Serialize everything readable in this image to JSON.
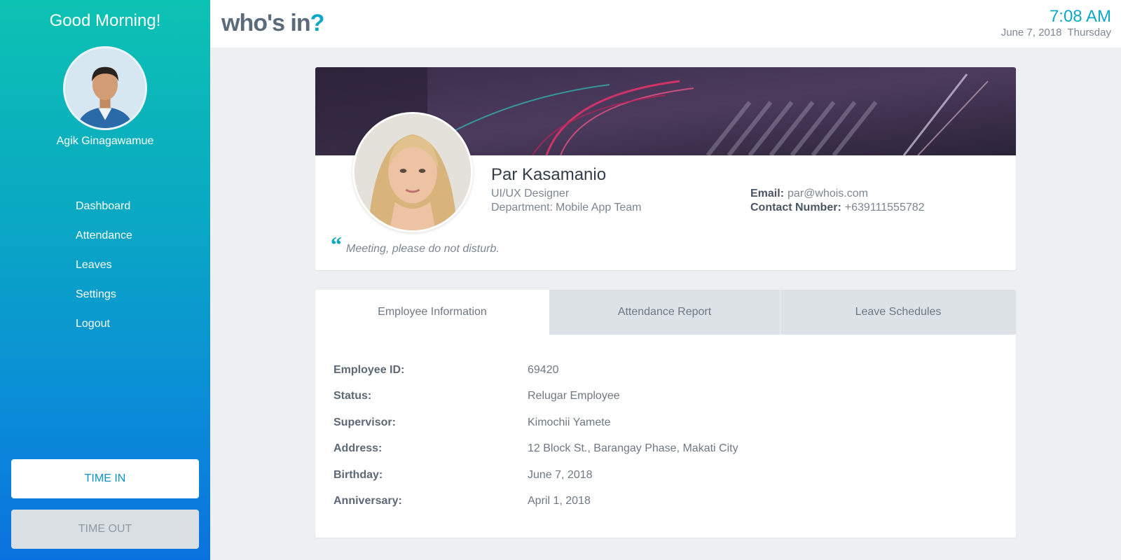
{
  "sidebar": {
    "greeting": "Good Morning!",
    "user_name": "Agik Ginagawamue",
    "nav": [
      "Dashboard",
      "Attendance",
      "Leaves",
      "Settings",
      "Logout"
    ],
    "time_in_label": "TIME IN",
    "time_out_label": "TIME OUT"
  },
  "header": {
    "logo_text": "who's in",
    "logo_mark": "?",
    "time": "7:08 AM",
    "date": "June 7, 2018",
    "day": "Thursday"
  },
  "profile": {
    "name": "Par Kasamanio",
    "title": "UI/UX Designer",
    "department_label": "Department:",
    "department": "Mobile App Team",
    "email_label": "Email:",
    "email": "par@whois.com",
    "contact_label": "Contact Number:",
    "contact": "+639111555782",
    "status_quote": "Meeting, please do not disturb."
  },
  "tabs": [
    "Employee Information",
    "Attendance Report",
    "Leave Schedules"
  ],
  "employee_info": [
    {
      "label": "Employee ID:",
      "value": "69420"
    },
    {
      "label": "Status:",
      "value": "Relugar Employee"
    },
    {
      "label": "Supervisor:",
      "value": "Kimochii Yamete"
    },
    {
      "label": "Address:",
      "value": "12 Block St., Barangay Phase, Makati City"
    },
    {
      "label": "Birthday:",
      "value": "June 7, 2018"
    },
    {
      "label": "Anniversary:",
      "value": "April 1, 2018"
    }
  ],
  "colors": {
    "accent": "#0ea8c6",
    "sidebar_top": "#0cc2b2",
    "sidebar_bottom": "#0a72de"
  }
}
